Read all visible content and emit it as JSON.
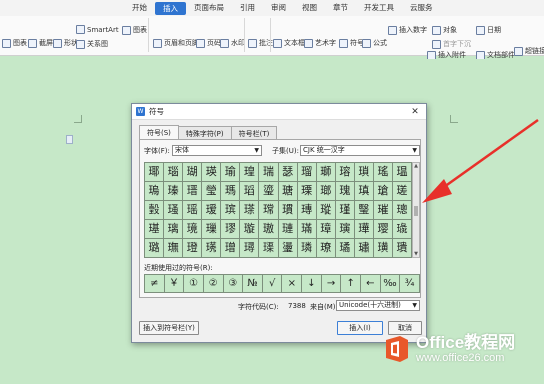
{
  "ribbon": {
    "tabs": [
      "开始",
      "插入",
      "页面布局",
      "引用",
      "审阅",
      "视图",
      "章节",
      "开发工具",
      "云服务"
    ],
    "active_tab": "插入",
    "buttons": {
      "picture": "图表",
      "screenshot": "截屏",
      "shape": "形状",
      "smartart": "SmartArt",
      "chart": "图表",
      "relation": "关系图",
      "header_footer": "页眉和页脚",
      "page_number": "页码",
      "watermark": "水印",
      "comment": "批注",
      "textbox": "文本框",
      "wordart": "艺术字",
      "symbol": "符号",
      "formula": "公式",
      "insert_number": "插入数字",
      "object": "对象",
      "first_drop": "首字下沉",
      "date": "日期",
      "attachment": "插入附件",
      "docparts": "文档部件",
      "hyperlink": "超链接"
    }
  },
  "dialog": {
    "title": "符号",
    "tabs": [
      "符号(S)",
      "特殊字符(P)",
      "符号栏(T)"
    ],
    "font_label": "字体(F):",
    "font_value": "宋体",
    "subset_label": "子集(U):",
    "subset_value": "CJK 统一汉字",
    "symbol_rows": [
      [
        "瑘",
        "瑙",
        "瑚",
        "瑛",
        "瑜",
        "瑝",
        "瑞",
        "瑟",
        "瑠",
        "瑡",
        "瑢",
        "瑣",
        "瑤",
        "瑥"
      ],
      [
        "瑦",
        "瑧",
        "瑨",
        "瑩",
        "瑪",
        "瑫",
        "瑬",
        "瑭",
        "瑮",
        "瑯",
        "瑰",
        "瑱",
        "瑲",
        "瑳"
      ],
      [
        "瑴",
        "瑵",
        "瑶",
        "瑷",
        "瑸",
        "瑹",
        "瑺",
        "瑻",
        "瑼",
        "瑽",
        "瑾",
        "瑿",
        "璀",
        "璁"
      ],
      [
        "璂",
        "璃",
        "璄",
        "璅",
        "璆",
        "璇",
        "璈",
        "璉",
        "璊",
        "璋",
        "璌",
        "璍",
        "璎",
        "璏"
      ],
      [
        "璐",
        "璑",
        "璒",
        "璓",
        "璔",
        "璕",
        "璖",
        "璗",
        "璘",
        "璙",
        "璚",
        "璛",
        "璜",
        "璝"
      ]
    ],
    "recent_label": "近期使用过的符号(R):",
    "recent_symbols": [
      "≠",
      "￥",
      "①",
      "②",
      "③",
      "№",
      "√",
      "×",
      "↓",
      "→",
      "↑",
      "←",
      "‰",
      "¾"
    ],
    "charcode_label": "字符代码(C):",
    "charcode_value": "7388",
    "from_label": "来自(M)",
    "from_value": "Unicode(十六进制)",
    "btn_insert_bar": "插入到符号栏(Y)",
    "btn_insert": "插入(I)",
    "btn_cancel": "取消"
  },
  "watermark_logo": {
    "line1": "Office教程网",
    "line2": "www.office26.com"
  },
  "colors": {
    "accent": "#2f74d0",
    "symbol_bg": "#c6e8c8",
    "arrow": "#e8302a",
    "logo": "#e8582a"
  }
}
